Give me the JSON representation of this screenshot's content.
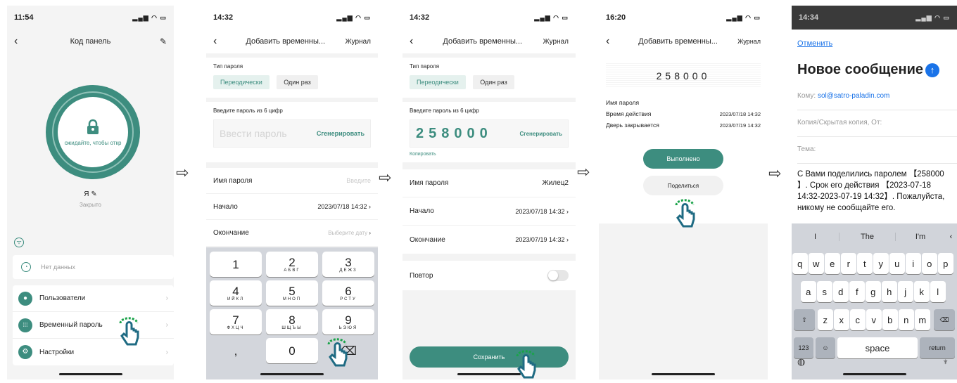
{
  "s1": {
    "time": "11:54",
    "title": "Код панель",
    "lock_text": "ожидайте, чтобы откр",
    "user_name": "Я",
    "user_status": "Закрыто",
    "no_data": "Нет данных",
    "menu": [
      {
        "label": "Пользователи"
      },
      {
        "label": "Временный пароль"
      },
      {
        "label": "Настройки"
      }
    ]
  },
  "s2": {
    "time": "14:32",
    "title": "Добавить временны...",
    "journal": "Журнал",
    "password_type_label": "Тип пароля",
    "type_periodic": "Переодически",
    "type_once": "Один раз",
    "enter_label": "Введите пароль из 6 цифр",
    "password_placeholder": "Ввести пароль",
    "generate": "Сгенерировать",
    "name_label": "Имя пароля",
    "name_placeholder": "Введите",
    "start_label": "Начало",
    "start_value": "2023/07/18 14:32",
    "end_label": "Окончание",
    "end_placeholder": "Выберите дату",
    "keys": [
      {
        "num": "1",
        "sub": ""
      },
      {
        "num": "2",
        "sub": "АБВГ"
      },
      {
        "num": "3",
        "sub": "ДЕЖЗ"
      },
      {
        "num": "4",
        "sub": "ИЙКЛ"
      },
      {
        "num": "5",
        "sub": "МНОП"
      },
      {
        "num": "6",
        "sub": "РСТУ"
      },
      {
        "num": "7",
        "sub": "ФХЦЧ"
      },
      {
        "num": "8",
        "sub": "ШЩЪЫ"
      },
      {
        "num": "9",
        "sub": "ЬЭЮЯ"
      },
      {
        "num": ",",
        "sub": ""
      },
      {
        "num": "0",
        "sub": ""
      },
      {
        "num": "⌫",
        "sub": ""
      }
    ]
  },
  "s3": {
    "time": "14:32",
    "title": "Добавить временны...",
    "journal": "Журнал",
    "password_type_label": "Тип пароля",
    "type_periodic": "Переодически",
    "type_once": "Один раз",
    "enter_label": "Введите пароль из 6 цифр",
    "password_value": "258000",
    "generate": "Сгенерировать",
    "copy": "Копировать",
    "name_label": "Имя пароля",
    "name_value": "Жилец2",
    "start_label": "Начало",
    "start_value": "2023/07/18 14:32",
    "end_label": "Окончание",
    "end_value": "2023/07/19 14:32",
    "repeat_label": "Повтор",
    "save": "Сохранить"
  },
  "s4": {
    "time": "16:20",
    "title": "Добавить временны...",
    "journal": "Журнал",
    "password_value": "258000",
    "name_label": "Имя пароля",
    "valid_label": "Время действия",
    "valid_value": "2023/07/18 14:32",
    "closes_label": "Дверь закрывается",
    "closes_value": "2023/07/19 14:32",
    "done": "Выполнено",
    "share": "Поделиться"
  },
  "s5": {
    "time": "14:34",
    "cancel": "Отменить",
    "title": "Новое сообщение",
    "to_label": "Кому:",
    "to_value": "sol@satro-paladin.com",
    "cc_label": "Копия/Скрытая копия, От:",
    "subject_label": "Тема:",
    "body": "С Вами поделились паролем 【258000 】. Срок его действия 【2023-07-18 14:32-2023-07-19 14:32】. Пожалуйста, никому не сообщайте его.",
    "suggestions": [
      "I",
      "The",
      "I'm"
    ],
    "row1": [
      "q",
      "w",
      "e",
      "r",
      "t",
      "y",
      "u",
      "i",
      "o",
      "p"
    ],
    "row2": [
      "a",
      "s",
      "d",
      "f",
      "g",
      "h",
      "j",
      "k",
      "l"
    ],
    "row3": [
      "z",
      "x",
      "c",
      "v",
      "b",
      "n",
      "m"
    ],
    "num_key": "123",
    "space": "space",
    "return": "return"
  },
  "colors": {
    "accent": "#3d8d7f",
    "hand": "#1f6b83",
    "press": "#1aa34a",
    "link": "#1a73e8"
  }
}
